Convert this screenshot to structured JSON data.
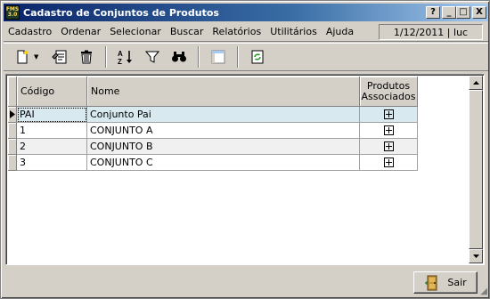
{
  "window": {
    "title": "Cadastro de Conjuntos de Produtos",
    "app_icon_text": "FMS 3.0",
    "controls": [
      "?",
      "_",
      "□",
      "X"
    ]
  },
  "menu": {
    "items": [
      {
        "label": "Cadastro"
      },
      {
        "label": "Ordenar"
      },
      {
        "label": "Selecionar"
      },
      {
        "label": "Buscar"
      },
      {
        "label": "Relatórios"
      },
      {
        "label": "Utilitários"
      },
      {
        "label": "Ajuda"
      }
    ],
    "status": "1/12/2011 | luc"
  },
  "toolbar": {
    "icons": [
      "new-record-icon",
      "edit-record-icon",
      "delete-icon",
      "sort-az-icon",
      "filter-icon",
      "find-icon",
      "layout-icon",
      "refresh-icon"
    ]
  },
  "grid": {
    "columns": [
      "Código",
      "Nome",
      "Produtos Associados"
    ],
    "rows": [
      {
        "codigo": "PAI",
        "nome": "Conjunto Pai"
      },
      {
        "codigo": "1",
        "nome": "CONJUNTO A"
      },
      {
        "codigo": "2",
        "nome": "CONJUNTO B"
      },
      {
        "codigo": "3",
        "nome": "CONJUNTO C"
      }
    ]
  },
  "footer": {
    "exit_label": "Sair"
  },
  "colors": {
    "title_start": "#0a246a",
    "title_end": "#a6caf0",
    "selected_row": "#d8eaf0",
    "face": "#d4d0c8"
  }
}
